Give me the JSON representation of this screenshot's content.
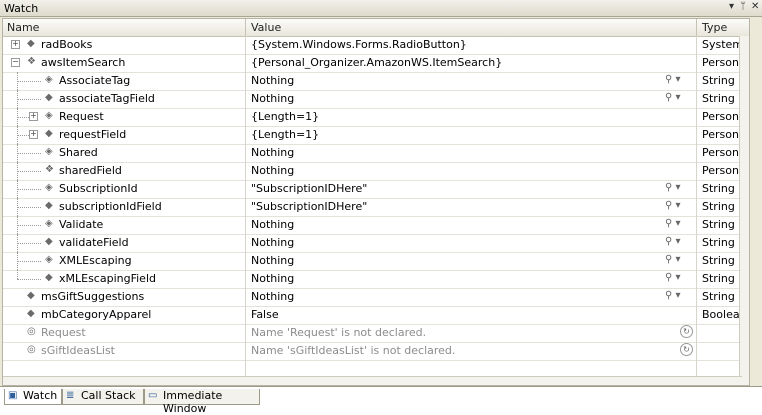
{
  "window": {
    "title": "Watch",
    "pin_icon": "pin-icon",
    "close_icon": "close-icon"
  },
  "columns": {
    "name": "Name",
    "value": "Value",
    "type": "Type"
  },
  "rows": [
    {
      "name": "radBooks",
      "value": "{System.Windows.Forms.RadioButton}",
      "type": "System.",
      "expander": "+",
      "icon": "field-icon"
    },
    {
      "name": "awsItemSearch",
      "value": "{Personal_Organizer.AmazonWS.ItemSearch}",
      "type": "Persona",
      "expander": "-",
      "icon": "class-icon"
    },
    {
      "name": "AssociateTag",
      "value": "Nothing",
      "type": "String",
      "icon": "property-icon",
      "magnify": true
    },
    {
      "name": "associateTagField",
      "value": "Nothing",
      "type": "String",
      "icon": "field-icon",
      "magnify": true
    },
    {
      "name": "Request",
      "value": "{Length=1}",
      "type": "Persona",
      "expander": "+",
      "icon": "property-icon"
    },
    {
      "name": "requestField",
      "value": "{Length=1}",
      "type": "Persona",
      "expander": "+",
      "icon": "field-icon"
    },
    {
      "name": "Shared",
      "value": "Nothing",
      "type": "Persona",
      "icon": "property-icon"
    },
    {
      "name": "sharedField",
      "value": "Nothing",
      "type": "Persona",
      "icon": "class-icon"
    },
    {
      "name": "SubscriptionId",
      "value": "\"SubscriptionIDHere\"",
      "type": "String",
      "icon": "property-icon",
      "magnify": true
    },
    {
      "name": "subscriptionIdField",
      "value": "\"SubscriptionIDHere\"",
      "type": "String",
      "icon": "field-icon",
      "magnify": true
    },
    {
      "name": "Validate",
      "value": "Nothing",
      "type": "String",
      "icon": "property-icon",
      "magnify": true
    },
    {
      "name": "validateField",
      "value": "Nothing",
      "type": "String",
      "icon": "field-icon",
      "magnify": true
    },
    {
      "name": "XMLEscaping",
      "value": "Nothing",
      "type": "String",
      "icon": "property-icon",
      "magnify": true
    },
    {
      "name": "xMLEscapingField",
      "value": "Nothing",
      "type": "String",
      "icon": "field-icon",
      "magnify": true
    },
    {
      "name": "msGiftSuggestions",
      "value": "Nothing",
      "type": "String",
      "icon": "field-icon",
      "magnify": true
    },
    {
      "name": "mbCategoryApparel",
      "value": "False",
      "type": "Boolean",
      "icon": "field-icon"
    },
    {
      "name": "Request",
      "value": "Name 'Request' is not declared.",
      "type": "",
      "icon": "error-icon",
      "refresh": true,
      "gray": true
    },
    {
      "name": "sGiftIdeasList",
      "value": "Name 'sGiftIdeasList' is not declared.",
      "type": "",
      "icon": "error-icon",
      "refresh": true,
      "gray": true
    }
  ],
  "tabs": [
    {
      "label": "Watch",
      "icon": "watch-icon",
      "active": true
    },
    {
      "label": "Call Stack",
      "icon": "call-stack-icon"
    },
    {
      "label": "Immediate Window",
      "icon": "immediate-window-icon"
    }
  ]
}
